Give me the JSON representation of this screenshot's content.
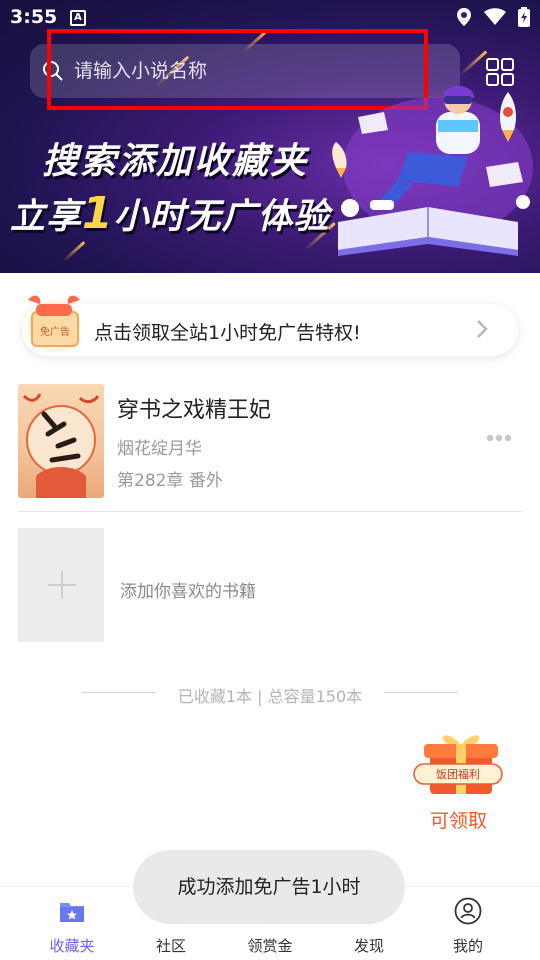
{
  "status_bar": {
    "time": "3:55",
    "notification_glyph": "A"
  },
  "header": {
    "search": {
      "placeholder": "请输入小说名称",
      "value": ""
    },
    "promo": {
      "line1": "搜索添加收藏夹",
      "line2_pre": "立享",
      "line2_hl": "1",
      "line2_post": "小时无广体验"
    }
  },
  "adfree_strip": {
    "text": "点击领取全站1小时免广告特权!",
    "badge_text": "免广告"
  },
  "bookshelf": {
    "books": [
      {
        "title": "穿书之戏精王妃",
        "author": "烟花绽月华",
        "latest": "第282章 番外"
      }
    ],
    "add_label": "添加你喜欢的书籍",
    "summary": "已收藏1本 | 总容量150本"
  },
  "gift": {
    "badge": "饭团福利",
    "label": "可领取"
  },
  "toast": {
    "text": "成功添加免广告1小时"
  },
  "bottom_nav": {
    "items": [
      {
        "label": "收藏夹",
        "icon": "bookmark-folder-icon",
        "active": true
      },
      {
        "label": "社区",
        "icon": "heart-circle-icon"
      },
      {
        "label": "领赏金",
        "icon": "diamond-circle-icon"
      },
      {
        "label": "发现",
        "icon": "compass-icon"
      },
      {
        "label": "我的",
        "icon": "user-icon"
      }
    ]
  },
  "colors": {
    "accent": "#6f63e6",
    "gift_orange": "#f0592a",
    "banner_dark": "#1f1450"
  }
}
